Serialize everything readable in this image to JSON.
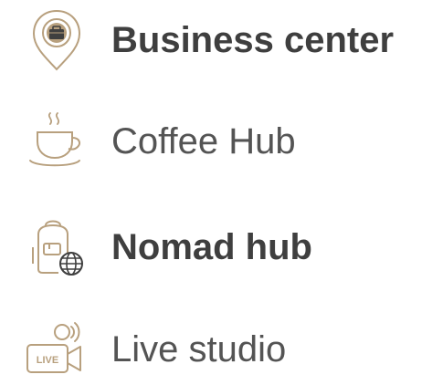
{
  "colors": {
    "accent": "#b8a07e",
    "text": "#4a4a4a"
  },
  "items": [
    {
      "label": "Business center",
      "icon": "map-pin-briefcase-icon",
      "weight": "bold"
    },
    {
      "label": "Coffee Hub",
      "icon": "coffee-cup-icon",
      "weight": "light"
    },
    {
      "label": "Nomad hub",
      "icon": "backpack-globe-icon",
      "weight": "bold"
    },
    {
      "label": "Live studio",
      "icon": "live-camera-icon",
      "weight": "light"
    }
  ]
}
